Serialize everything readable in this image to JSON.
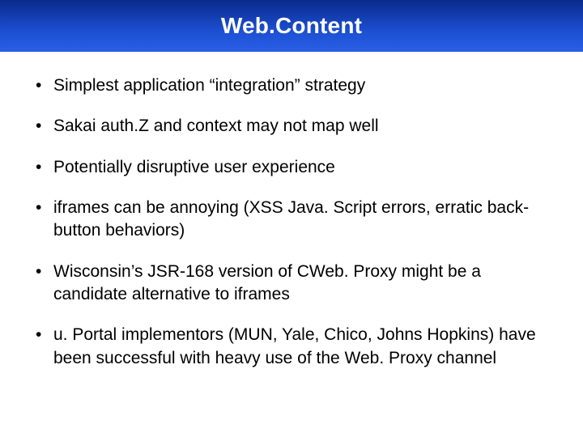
{
  "title": "Web.Content",
  "bullets": [
    "Simplest application “integration” strategy",
    "Sakai auth.Z and context may not map well",
    "Potentially disruptive user experience",
    "iframes can be annoying (XSS Java. Script errors, erratic back-button behaviors)",
    "Wisconsin’s JSR-168 version of CWeb. Proxy might be a candidate alternative to iframes",
    "u. Portal implementors (MUN, Yale, Chico, Johns Hopkins) have been successful with heavy use of the Web. Proxy channel"
  ]
}
